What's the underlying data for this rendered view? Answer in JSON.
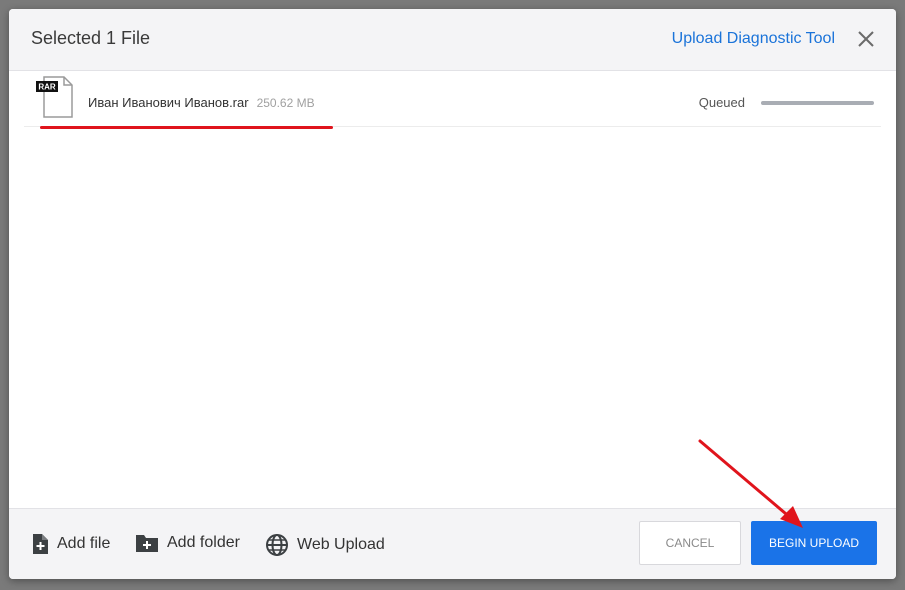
{
  "dialog": {
    "title": "Selected 1 File",
    "diagnostic_link": "Upload Diagnostic Tool"
  },
  "file": {
    "type_badge": "RAR",
    "name": "Иван Иванович Иванов.rar",
    "size": "250.62 MB",
    "status": "Queued",
    "progress": 0
  },
  "footer": {
    "add_file": "Add file",
    "add_folder": "Add folder",
    "web_upload": "Web Upload",
    "cancel": "CANCEL",
    "begin_upload": "BEGIN UPLOAD"
  },
  "annotations": {
    "underline_color": "#e0141c",
    "arrow_color": "#e0141c"
  },
  "colors": {
    "accent": "#1a73e8",
    "link": "#1a73d9"
  }
}
